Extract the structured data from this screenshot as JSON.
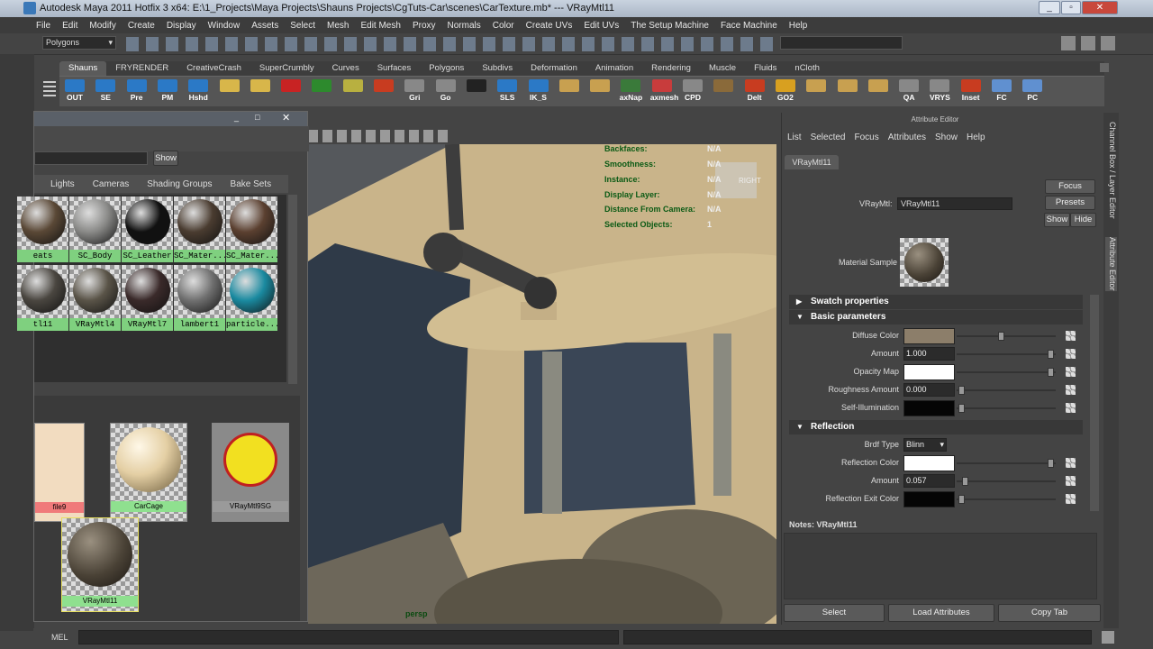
{
  "window": {
    "title": "Autodesk Maya 2011 Hotfix 3 x64: E:\\1_Projects\\Maya Projects\\Shauns Projects\\CgTuts-Car\\scenes\\CarTexture.mb*  ---  VRayMtl11"
  },
  "menu": [
    "File",
    "Edit",
    "Modify",
    "Create",
    "Display",
    "Window",
    "Assets",
    "Select",
    "Mesh",
    "Edit Mesh",
    "Proxy",
    "Normals",
    "Color",
    "Create UVs",
    "Edit UVs",
    "The Setup Machine",
    "Face Machine",
    "Help"
  ],
  "status": {
    "mode": "Polygons"
  },
  "shelf_tabs": [
    "Shauns",
    "FRYRENDER",
    "CreativeCrash",
    "SuperCrumbly",
    "Curves",
    "Surfaces",
    "Polygons",
    "Subdivs",
    "Deformation",
    "Animation",
    "Rendering",
    "Muscle",
    "Fluids",
    "nCloth"
  ],
  "shelf_buttons": [
    {
      "label": "OUT",
      "color": "#2b79c6"
    },
    {
      "label": "SE",
      "color": "#2b79c6"
    },
    {
      "label": "Pre",
      "color": "#2b79c6"
    },
    {
      "label": "PM",
      "color": "#2b79c6"
    },
    {
      "label": "Hshd",
      "color": "#2b79c6"
    },
    {
      "label": "",
      "color": "#d8b64a"
    },
    {
      "label": "",
      "color": "#d8b64a"
    },
    {
      "label": "",
      "color": "#c82323"
    },
    {
      "label": "",
      "color": "#2d8a2d"
    },
    {
      "label": "",
      "color": "#b8b040"
    },
    {
      "label": "",
      "color": "#c83c20"
    },
    {
      "label": "Gri",
      "color": "#888"
    },
    {
      "label": "Go",
      "color": "#888"
    },
    {
      "label": "",
      "color": "#222"
    },
    {
      "label": "SLS",
      "color": "#2b79c6"
    },
    {
      "label": "IK_S",
      "color": "#2b79c6"
    },
    {
      "label": "",
      "color": "#c8a050"
    },
    {
      "label": "",
      "color": "#c8a050"
    },
    {
      "label": "axNap",
      "color": "#3a7a3a"
    },
    {
      "label": "axmesh",
      "color": "#c83c3c"
    },
    {
      "label": "CPD",
      "color": "#888"
    },
    {
      "label": "",
      "color": "#8a6a3a"
    },
    {
      "label": "Delt",
      "color": "#c83c20"
    },
    {
      "label": "GO2",
      "color": "#d8a020"
    },
    {
      "label": "",
      "color": "#c8a050"
    },
    {
      "label": "",
      "color": "#c8a050"
    },
    {
      "label": "",
      "color": "#c8a050"
    },
    {
      "label": "QA",
      "color": "#888"
    },
    {
      "label": "VRYS",
      "color": "#888"
    },
    {
      "label": "Inset",
      "color": "#c83c20"
    },
    {
      "label": "FC",
      "color": "#6090d0"
    },
    {
      "label": "PC",
      "color": "#6090d0"
    }
  ],
  "hypershade": {
    "show_button": "Show",
    "tabs": [
      "Lights",
      "Cameras",
      "Shading Groups",
      "Bake Sets"
    ],
    "materials_row1": [
      {
        "name": "eats",
        "tone": "#5a4836"
      },
      {
        "name": "SC_Body",
        "tone": "#8a8a88"
      },
      {
        "name": "SC_Leather",
        "tone": "#111111"
      },
      {
        "name": "SC_Mater...",
        "tone": "#4a3c30"
      },
      {
        "name": "SC_Mater...",
        "tone": "#5b4030"
      }
    ],
    "materials_row2": [
      {
        "name": "tl11",
        "tone": "#4a4640"
      },
      {
        "name": "VRayMtl4",
        "tone": "#5a5448"
      },
      {
        "name": "VRayMtl7",
        "tone": "#3a2a2a"
      },
      {
        "name": "lambert1",
        "tone": "#707070"
      },
      {
        "name": "particle...",
        "tone": "#1a8aa0"
      }
    ],
    "nodes": {
      "file": "file9",
      "carcage": "CarCage",
      "sg": "VRayMtl9SG",
      "mat": "VRayMtl11"
    }
  },
  "viewport": {
    "camera": "persp",
    "hud": [
      {
        "label": "Backfaces:",
        "value": "N/A"
      },
      {
        "label": "Smoothness:",
        "value": "N/A"
      },
      {
        "label": "Instance:",
        "value": "N/A"
      },
      {
        "label": "Display Layer:",
        "value": "N/A"
      },
      {
        "label": "Distance From Camera:",
        "value": "N/A"
      },
      {
        "label": "Selected Objects:",
        "value": "1"
      }
    ],
    "viewcube": "RIGHT"
  },
  "attribute_editor": {
    "title": "Attribute Editor",
    "menu": [
      "List",
      "Selected",
      "Focus",
      "Attributes",
      "Show",
      "Help"
    ],
    "tab": "VRayMtl11",
    "name_label": "VRayMtl:",
    "name_value": "VRayMtl11",
    "focus": "Focus",
    "presets": "Presets",
    "show": "Show",
    "hide": "Hide",
    "sample_label": "Material Sample",
    "sections": {
      "swatch": "Swatch properties",
      "basic": "Basic parameters",
      "reflection": "Reflection"
    },
    "basic": [
      {
        "label": "Diffuse Color",
        "type": "color",
        "color": "#8c7e6a",
        "knob": 0.45
      },
      {
        "label": "Amount",
        "type": "num",
        "value": "1.000",
        "knob": 0.98
      },
      {
        "label": "Opacity Map",
        "type": "color",
        "color": "#ffffff",
        "knob": 0.98
      },
      {
        "label": "Roughness Amount",
        "type": "num",
        "value": "0.000",
        "knob": 0.02
      },
      {
        "label": "Self-Illumination",
        "type": "color",
        "color": "#050505",
        "knob": 0.02
      }
    ],
    "reflection": [
      {
        "label": "Brdf Type",
        "type": "drop",
        "value": "Blinn"
      },
      {
        "label": "Reflection Color",
        "type": "color",
        "color": "#ffffff",
        "knob": 0.98
      },
      {
        "label": "Amount",
        "type": "num",
        "value": "0.057",
        "knob": 0.06
      },
      {
        "label": "Reflection Exit Color",
        "type": "color",
        "color": "#050505",
        "knob": 0.02
      }
    ],
    "notes_label": "Notes:  VRayMtl11",
    "buttons": [
      "Select",
      "Load Attributes",
      "Copy Tab"
    ]
  },
  "side_tabs": [
    "Channel Box / Layer Editor",
    "Attribute Editor"
  ],
  "mel": {
    "label": "MEL"
  }
}
